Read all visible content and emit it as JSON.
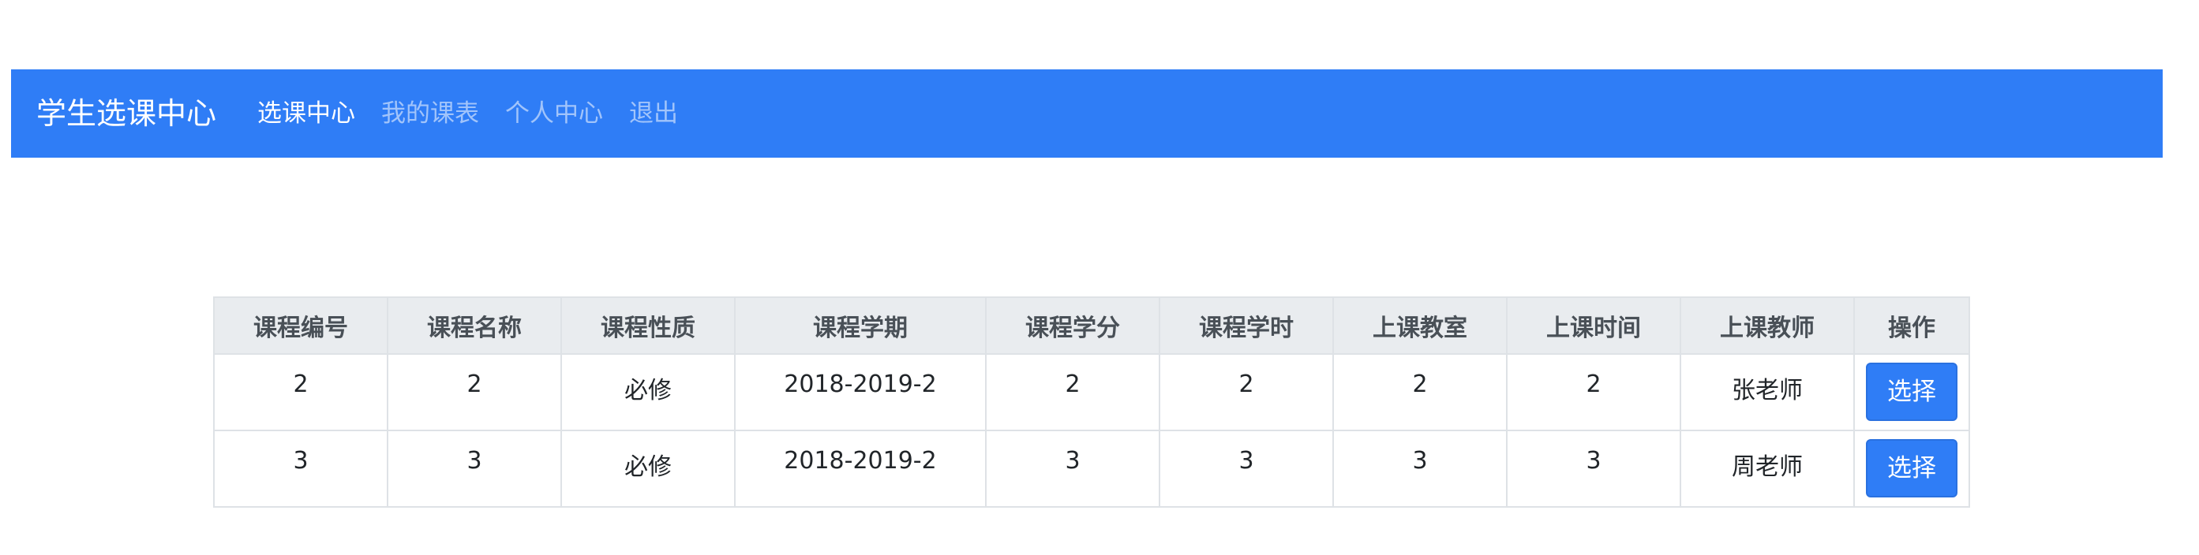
{
  "navbar": {
    "brand": "学生选课中心",
    "links": [
      {
        "label": "选课中心",
        "active": true
      },
      {
        "label": "我的课表",
        "active": false
      },
      {
        "label": "个人中心",
        "active": false
      },
      {
        "label": "退出",
        "active": false
      }
    ]
  },
  "table": {
    "headers": [
      "课程编号",
      "课程名称",
      "课程性质",
      "课程学期",
      "课程学分",
      "课程学时",
      "上课教室",
      "上课时间",
      "上课教师",
      "操作"
    ],
    "rows": [
      {
        "cells": [
          "2",
          "2",
          "必修",
          "2018-2019-2",
          "2",
          "2",
          "2",
          "2",
          "张老师"
        ],
        "action": "选择"
      },
      {
        "cells": [
          "3",
          "3",
          "必修",
          "2018-2019-2",
          "3",
          "3",
          "3",
          "3",
          "周老师"
        ],
        "action": "选择"
      }
    ]
  },
  "colors": {
    "primary": "#2f7df6",
    "header_bg": "#e9ecef",
    "border": "#dee2e6"
  }
}
